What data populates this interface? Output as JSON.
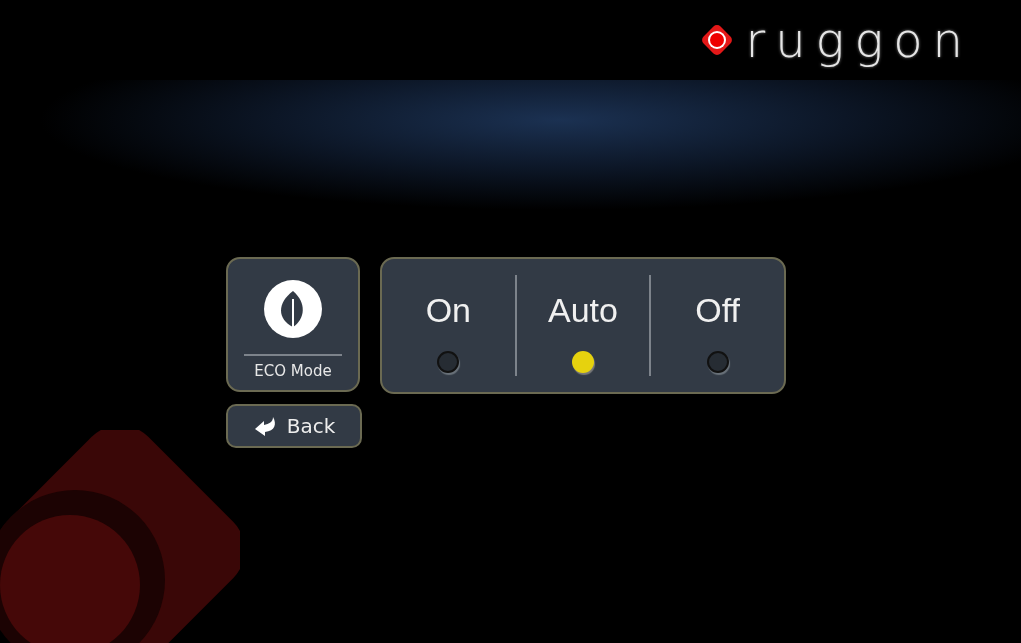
{
  "logo": {
    "text": "ruggon"
  },
  "mode_tile": {
    "label": "ECO Mode"
  },
  "back_button": {
    "label": "Back"
  },
  "options": [
    {
      "label": "On",
      "selected": false
    },
    {
      "label": "Auto",
      "selected": true
    },
    {
      "label": "Off",
      "selected": false
    }
  ]
}
